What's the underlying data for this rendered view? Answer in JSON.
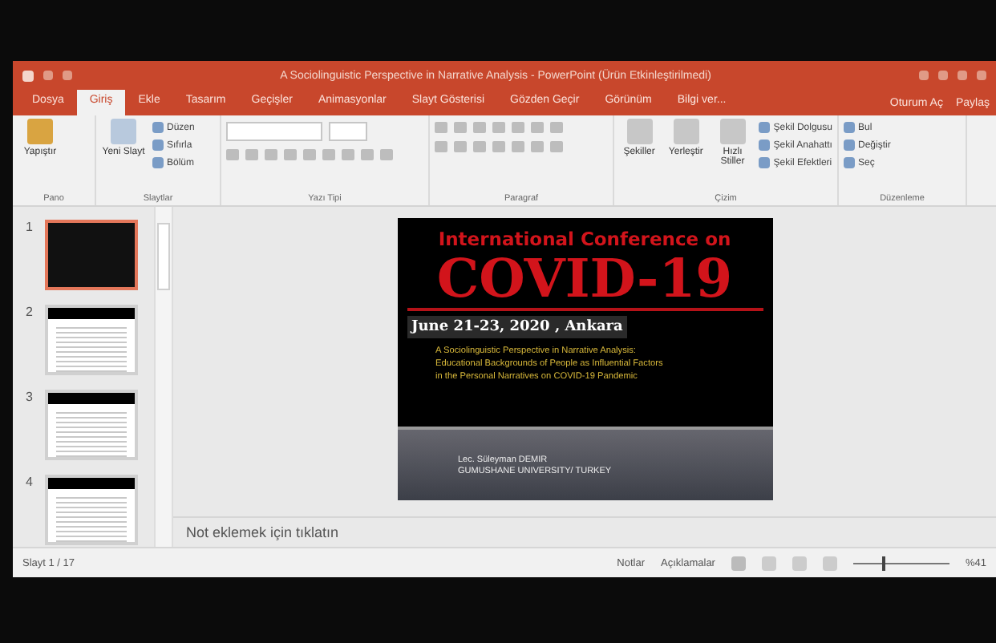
{
  "window": {
    "title": "A Sociolinguistic Perspective in Narrative Analysis - PowerPoint (Ürün Etkinleştirilmedi)",
    "account": "Oturum Aç",
    "share": "Paylaş"
  },
  "tabs": [
    {
      "label": "Dosya",
      "selected": false
    },
    {
      "label": "Giriş",
      "selected": true
    },
    {
      "label": "Ekle",
      "selected": false
    },
    {
      "label": "Tasarım",
      "selected": false
    },
    {
      "label": "Geçişler",
      "selected": false
    },
    {
      "label": "Animasyonlar",
      "selected": false
    },
    {
      "label": "Slayt Gösterisi",
      "selected": false
    },
    {
      "label": "Gözden Geçir",
      "selected": false
    },
    {
      "label": "Görünüm",
      "selected": false
    },
    {
      "label": "Bilgi ver...",
      "selected": false
    }
  ],
  "ribbon": {
    "groups": [
      {
        "name": "Pano",
        "large": [
          "Yapıştır"
        ]
      },
      {
        "name": "Slaytlar",
        "large": [
          "Yeni Slayt"
        ],
        "small": [
          "Düzen",
          "Sıfırla",
          "Bölüm"
        ]
      },
      {
        "name": "Yazı Tipi"
      },
      {
        "name": "Paragraf"
      },
      {
        "name": "Çizim",
        "large": [
          "Şekiller",
          "Yerleştir",
          "Hızlı Stiller"
        ],
        "small": [
          "Şekil Dolgusu",
          "Şekil Anahattı",
          "Şekil Efektleri"
        ]
      },
      {
        "name": "Düzenleme",
        "small": [
          "Bul",
          "Değiştir",
          "Seç"
        ]
      }
    ]
  },
  "thumbnails": [
    {
      "number": "1",
      "selected": true
    },
    {
      "number": "2",
      "selected": false
    },
    {
      "number": "3",
      "selected": false
    },
    {
      "number": "4",
      "selected": false
    }
  ],
  "slide": {
    "heading": "International Conference on",
    "title": "COVID-19",
    "date": "June 21-23, 2020 , Ankara",
    "subtitle": [
      "A Sociolinguistic Perspective in Narrative Analysis:",
      "Educational Backgrounds of People as Influential Factors",
      "in the Personal Narratives on COVID-19 Pandemic"
    ],
    "author": "Lec. Süleyman DEMIR",
    "affiliation": "GUMUSHANE UNIVERSITY/ TURKEY"
  },
  "notes": {
    "placeholder": "Not eklemek için tıklatın"
  },
  "status_bar": {
    "slide": "Slayt 1 / 17",
    "notes": "Notlar",
    "comments": "Açıklamalar",
    "zoom": "%41",
    "level": 0.3
  }
}
